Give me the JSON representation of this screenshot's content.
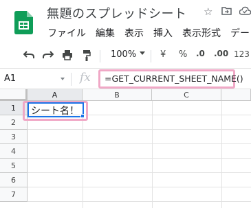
{
  "app": {
    "title": "無題のスプレッドシート",
    "logo_icon": "google-sheets-logo",
    "star_icon": "☆",
    "move_icon": "⇢",
    "status_icon": "☁"
  },
  "menubar": {
    "items": [
      "ファイル",
      "編集",
      "表示",
      "挿入",
      "表示形式",
      "デー"
    ]
  },
  "toolbar": {
    "undo": "↶",
    "redo": "↷",
    "print": "⎙",
    "paint_format": "🖌",
    "zoom": "100%",
    "currency": "¥",
    "percent": "%",
    "decrease_decimal": ".0",
    "increase_decimal": ".00",
    "more_formats": "123"
  },
  "formula_bar": {
    "cell_ref": "A1",
    "fx": "fx",
    "formula": "=GET_CURRENT_SHEET_NAME()"
  },
  "grid": {
    "columns": [
      "A",
      "B",
      "C"
    ],
    "rows": [
      "1",
      "2",
      "3",
      "4",
      "5",
      "6",
      "7"
    ],
    "selected_cell": "A1",
    "cell_a1_value": "シート名！"
  },
  "colors": {
    "accent": "#1a73e8",
    "highlight": "#f0a8c6",
    "sheets_green": "#0f9d58"
  }
}
